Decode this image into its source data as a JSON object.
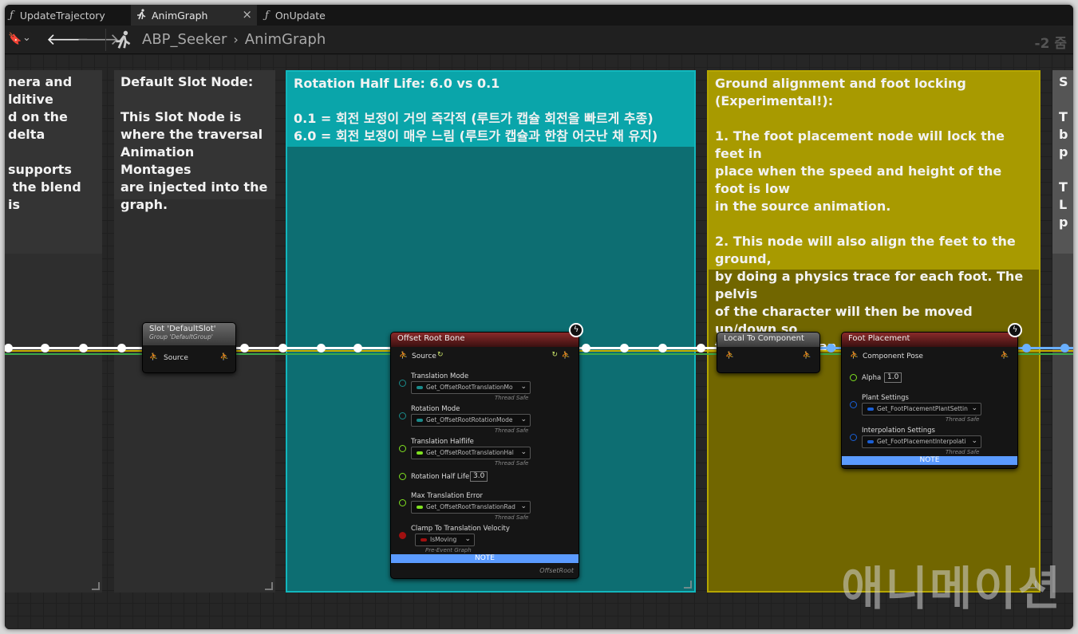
{
  "tabs": [
    {
      "label": "UpdateTrajectory",
      "icon": "function-icon"
    },
    {
      "label": "AnimGraph",
      "icon": "running-man-icon",
      "close": "×"
    },
    {
      "label": "OnUpdate",
      "icon": "function-icon"
    }
  ],
  "breadcrumb": {
    "root": "ABP_Seeker",
    "sep": "›",
    "current": "AnimGraph"
  },
  "zoom": "-2 줌",
  "comments": {
    "left": "nera and\nlditive\nd on the delta\n\nsupports\n the blend is",
    "slot": "Default Slot Node:\n\nThis Slot Node is\nwhere the traversal\nAnimation Montages\nare injected into the\ngraph.",
    "rotation": "Rotation Half Life: 6.0 vs 0.1\n\n0.1 = 회전 보정이 거의 즉각적 (루트가 캡슐 회전을 빠르게 추종)\n6.0 = 회전 보정이 매우 느림 (루트가 캡슐과 한참 어긋난 채 유지)",
    "ground": "Ground alignment and foot locking\n(Experimental!):\n\n1. The foot placement node will lock the feet in\nplace when the speed and height of the foot is low\nin the source animation.\n\n2. This node will also align the feet to the ground,\nby doing a physics trace for each foot. The pelvis\nof the character will then be moved up/down so\nthat the foot can reach the ground.",
    "right": "S\n\nT\nb\np\n\nT\nL\np"
  },
  "nodes": {
    "slot": {
      "title": "Slot 'DefaultSlot'",
      "subtitle": "Group 'DefaultGroup'",
      "pin": "Source"
    },
    "offset": {
      "title": "Offset Root Bone",
      "source": "Source",
      "translation_mode": "Translation Mode",
      "translation_mode_get": "Get_OffsetRootTranslationMo",
      "rotation_mode": "Rotation Mode",
      "rotation_mode_get": "Get_OffsetRootRotationMode",
      "translation_halflife": "Translation Halflife",
      "translation_halflife_get": "Get_OffsetRootTranslationHal",
      "rotation_half_life": "Rotation Half Life",
      "rotation_half_life_val": "3.0",
      "max_translation_error": "Max Translation Error",
      "max_translation_error_get": "Get_OffsetRootTranslationRad",
      "clamp": "Clamp To Translation Velocity",
      "clamp_get": "IsMoving",
      "thread_safe": "Thread Safe",
      "pre_event": "Pre-Event Graph",
      "note": "NOTE",
      "footer": "OffsetRoot"
    },
    "local": {
      "title": "Local To Component"
    },
    "foot": {
      "title": "Foot Placement",
      "component_pose": "Component Pose",
      "alpha": "Alpha",
      "alpha_val": "1.0",
      "plant": "Plant Settings",
      "plant_get": "Get_FootPlacementPlantSettin",
      "interp": "Interpolation Settings",
      "interp_get": "Get_FootPlacementInterpolati",
      "thread_safe": "Thread Safe",
      "note": "NOTE"
    }
  },
  "watermark": "애니메이션",
  "colors": {
    "teal": "#0aa5aa",
    "olive": "#a89a00",
    "node_header_red": "#6b1e1e",
    "node_header_gray": "#555555",
    "note_blue": "#5b9bff"
  }
}
